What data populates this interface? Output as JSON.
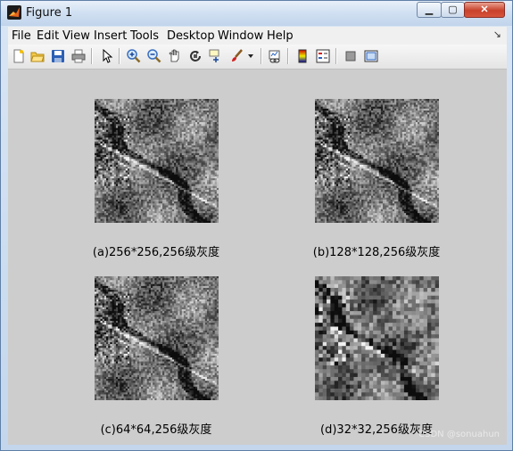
{
  "window": {
    "title": "Figure 1",
    "minimize_glyph": "▁",
    "maximize_glyph": "▢",
    "close_glyph": "✕"
  },
  "menu": {
    "items": [
      "File",
      "Edit",
      "View",
      "Insert",
      "Tools",
      "Desktop",
      "Window",
      "Help"
    ],
    "dock_glyph": "↘"
  },
  "toolbar": {
    "icons": [
      "new-figure-icon",
      "open-file-icon",
      "save-icon",
      "print-icon",
      "edit-plot-arrow-icon",
      "zoom-in-icon",
      "zoom-out-icon",
      "pan-hand-icon",
      "rotate-3d-icon",
      "data-cursor-icon",
      "brush-icon",
      "brush-dropdown-icon",
      "link-plot-icon",
      "colorbar-icon",
      "legend-icon",
      "hide-plot-tools-icon",
      "show-plot-tools-icon"
    ]
  },
  "figure": {
    "subplots": [
      {
        "caption": "(a)256*256,256级灰度",
        "grid": 64
      },
      {
        "caption": "(b)128*128,256级灰度",
        "grid": 64
      },
      {
        "caption": "(c)64*64,256级灰度",
        "grid": 64
      },
      {
        "caption": "(d)32*32,256级灰度",
        "grid": 32
      }
    ],
    "watermark": "CSDN @sonuahun"
  }
}
